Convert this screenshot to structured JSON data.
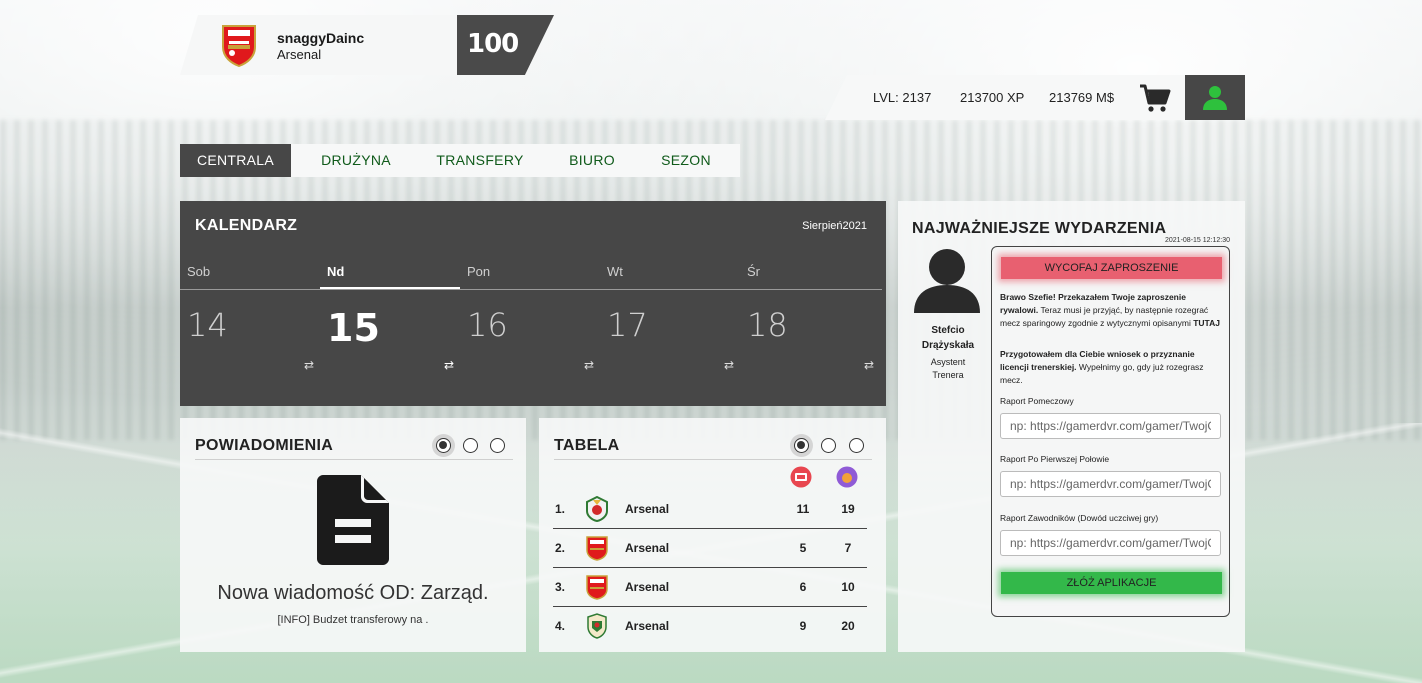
{
  "header": {
    "username": "snaggyDainc",
    "club": "Arsenal",
    "rating": "100",
    "crest_icon": "arsenal-crest-icon"
  },
  "stats": {
    "level": "LVL: 2137",
    "xp": "213700 XP",
    "money": "213769 M$",
    "cart_icon": "cart-icon",
    "profile_icon": "user-icon"
  },
  "nav": {
    "tabs": [
      {
        "label": "CENTRALA",
        "active": true
      },
      {
        "label": "DRUŻYNA",
        "active": false
      },
      {
        "label": "TRANSFERY",
        "active": false
      },
      {
        "label": "BIURO",
        "active": false
      },
      {
        "label": "SEZON",
        "active": false
      }
    ]
  },
  "calendar": {
    "title": "KALENDARZ",
    "month": "Sierpień2021",
    "days": [
      {
        "name": "Sob",
        "num": "14",
        "active": false
      },
      {
        "name": "Nd",
        "num": "15",
        "active": true
      },
      {
        "name": "Pon",
        "num": "16",
        "active": false
      },
      {
        "name": "Wt",
        "num": "17",
        "active": false
      },
      {
        "name": "Śr",
        "num": "18",
        "active": false
      }
    ],
    "swap_icon": "⇄"
  },
  "notifications": {
    "title": "POWIADOMIENIA",
    "message": "Nowa wiadomość OD: Zarząd.",
    "sub": "[INFO] Budzet transferowy na ."
  },
  "table": {
    "title": "TABELA",
    "rows": [
      {
        "pos": "1.",
        "name": "Arsenal",
        "played": "11",
        "points": "19"
      },
      {
        "pos": "2.",
        "name": "Arsenal",
        "played": "5",
        "points": "7"
      },
      {
        "pos": "3.",
        "name": "Arsenal",
        "played": "6",
        "points": "10"
      },
      {
        "pos": "4.",
        "name": "Arsenal",
        "played": "9",
        "points": "20"
      }
    ]
  },
  "events": {
    "title": "NAJWAŻNIEJSZE WYDARZENIA",
    "timestamp": "2021-08-15 12:12:30",
    "assistant_name_1": "Stefcio",
    "assistant_name_2": "Drążyskała",
    "assistant_role_1": "Asystent",
    "assistant_role_2": "Trenera",
    "withdraw_btn": "WYCOFAJ ZAPROSZENIE",
    "msg1_bold": "Brawo Szefie! Przekazałem Twoje zaproszenie rywalowi.",
    "msg1_rest": " Teraz musi je przyjąć, by następnie rozegrać mecz sparingowy zgodnie z wytycznymi opisanymi ",
    "msg1_link": "TUTAJ",
    "msg2_bold": "Przygotowałem dla Ciebie wniosek o przyznanie licencji trenerskiej.",
    "msg2_rest": " Wypełnimy go, gdy już rozegrasz mecz.",
    "label1": "Raport Pomeczowy",
    "label2": "Raport Po Pierwszej Połowie",
    "label3": "Raport Zawodników (Dowód uczciwej gry)",
    "placeholder": "np: https://gamerdvr.com/gamer/TwojGamertag",
    "submit_btn": "ZŁÓŻ APLIKACJE"
  }
}
